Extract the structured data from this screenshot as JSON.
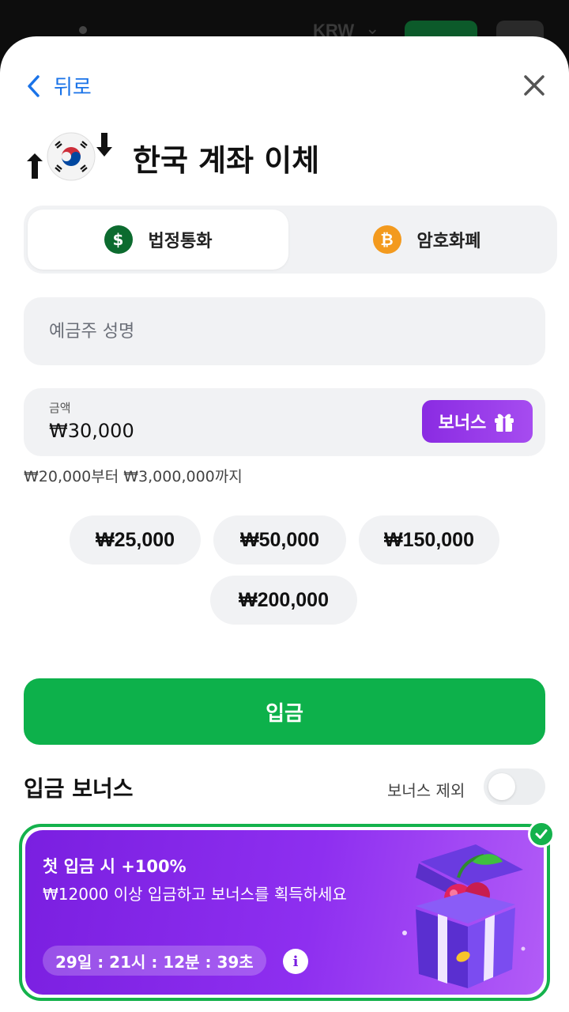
{
  "background": {
    "currency": "KRW"
  },
  "nav": {
    "back_label": "뒤로"
  },
  "title": "한국 계좌 이체",
  "tabs": [
    {
      "label": "법정통화",
      "icon": "dollar-coin-icon",
      "symbol": "$",
      "active": true
    },
    {
      "label": "암호화폐",
      "icon": "bitcoin-icon",
      "symbol": "₿",
      "active": false
    }
  ],
  "form": {
    "name_placeholder": "예금주 성명",
    "amount_label": "금액",
    "amount_value": "₩30,000",
    "bonus_button": "보너스",
    "range_text": "₩20,000부터 ₩3,000,000까지"
  },
  "quick_amounts": [
    "₩25,000",
    "₩50,000",
    "₩150,000",
    "₩200,000"
  ],
  "deposit_button": "입금",
  "bonus_section": {
    "heading": "입금 보너스",
    "exclude_label": "보너스 제외",
    "exclude_on": false,
    "card": {
      "title": "첫 입금 시 +100%",
      "description": "₩12000 이상 입금하고 보너스를 획득하세요",
      "timer": "29일 : 21시 : 12분 : 39초",
      "info_symbol": "i",
      "selected": true
    }
  },
  "colors": {
    "accent_blue": "#1a73e8",
    "primary_green": "#0db14b",
    "bonus_purple": "#8a2be2",
    "bitcoin_orange": "#f39a1e"
  }
}
